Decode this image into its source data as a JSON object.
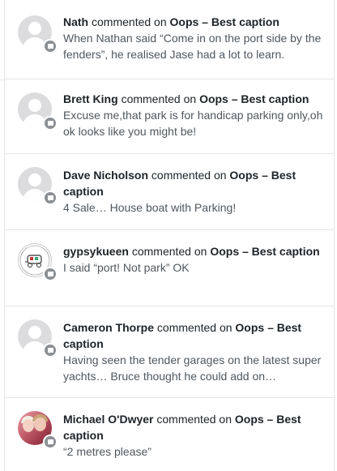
{
  "comments": [
    {
      "author": "Nath",
      "verb": "commented on",
      "post": "Oops – Best caption",
      "excerpt": "When Nathan said “Come in on the port side by the fenders”, he realised Jase had a lot to learn.",
      "avatar": "default"
    },
    {
      "author": "Brett King",
      "verb": "commented on",
      "post": "Oops – Best caption",
      "excerpt": "Excuse me,that park is for handicap parking only,oh ok looks like you might be!",
      "avatar": "default"
    },
    {
      "author": "Dave Nicholson",
      "verb": "commented on",
      "post": "Oops – Best caption",
      "excerpt": "4 Sale… House boat with Parking!",
      "avatar": "default"
    },
    {
      "author": "gypsykueen",
      "verb": "commented on",
      "post": "Oops – Best caption",
      "excerpt": "I said “port! Not park” OK",
      "avatar": "gypsy-logo",
      "avatar_text": "from the wagon of the gypsy queen"
    },
    {
      "author": "Cameron Thorpe",
      "verb": "commented on",
      "post": "Oops – Best caption",
      "excerpt": "Having seen the tender garages on the latest super yachts… Bruce thought he could add on…",
      "avatar": "default"
    },
    {
      "author": "Michael O'Dwyer",
      "verb": "commented on",
      "post": "Oops – Best caption",
      "excerpt": "“2 metres please”",
      "avatar": "photo"
    }
  ],
  "colors": {
    "badge": "#8c8f94",
    "avatar_default": "#dcdcde",
    "border": "#e2e4e7"
  }
}
